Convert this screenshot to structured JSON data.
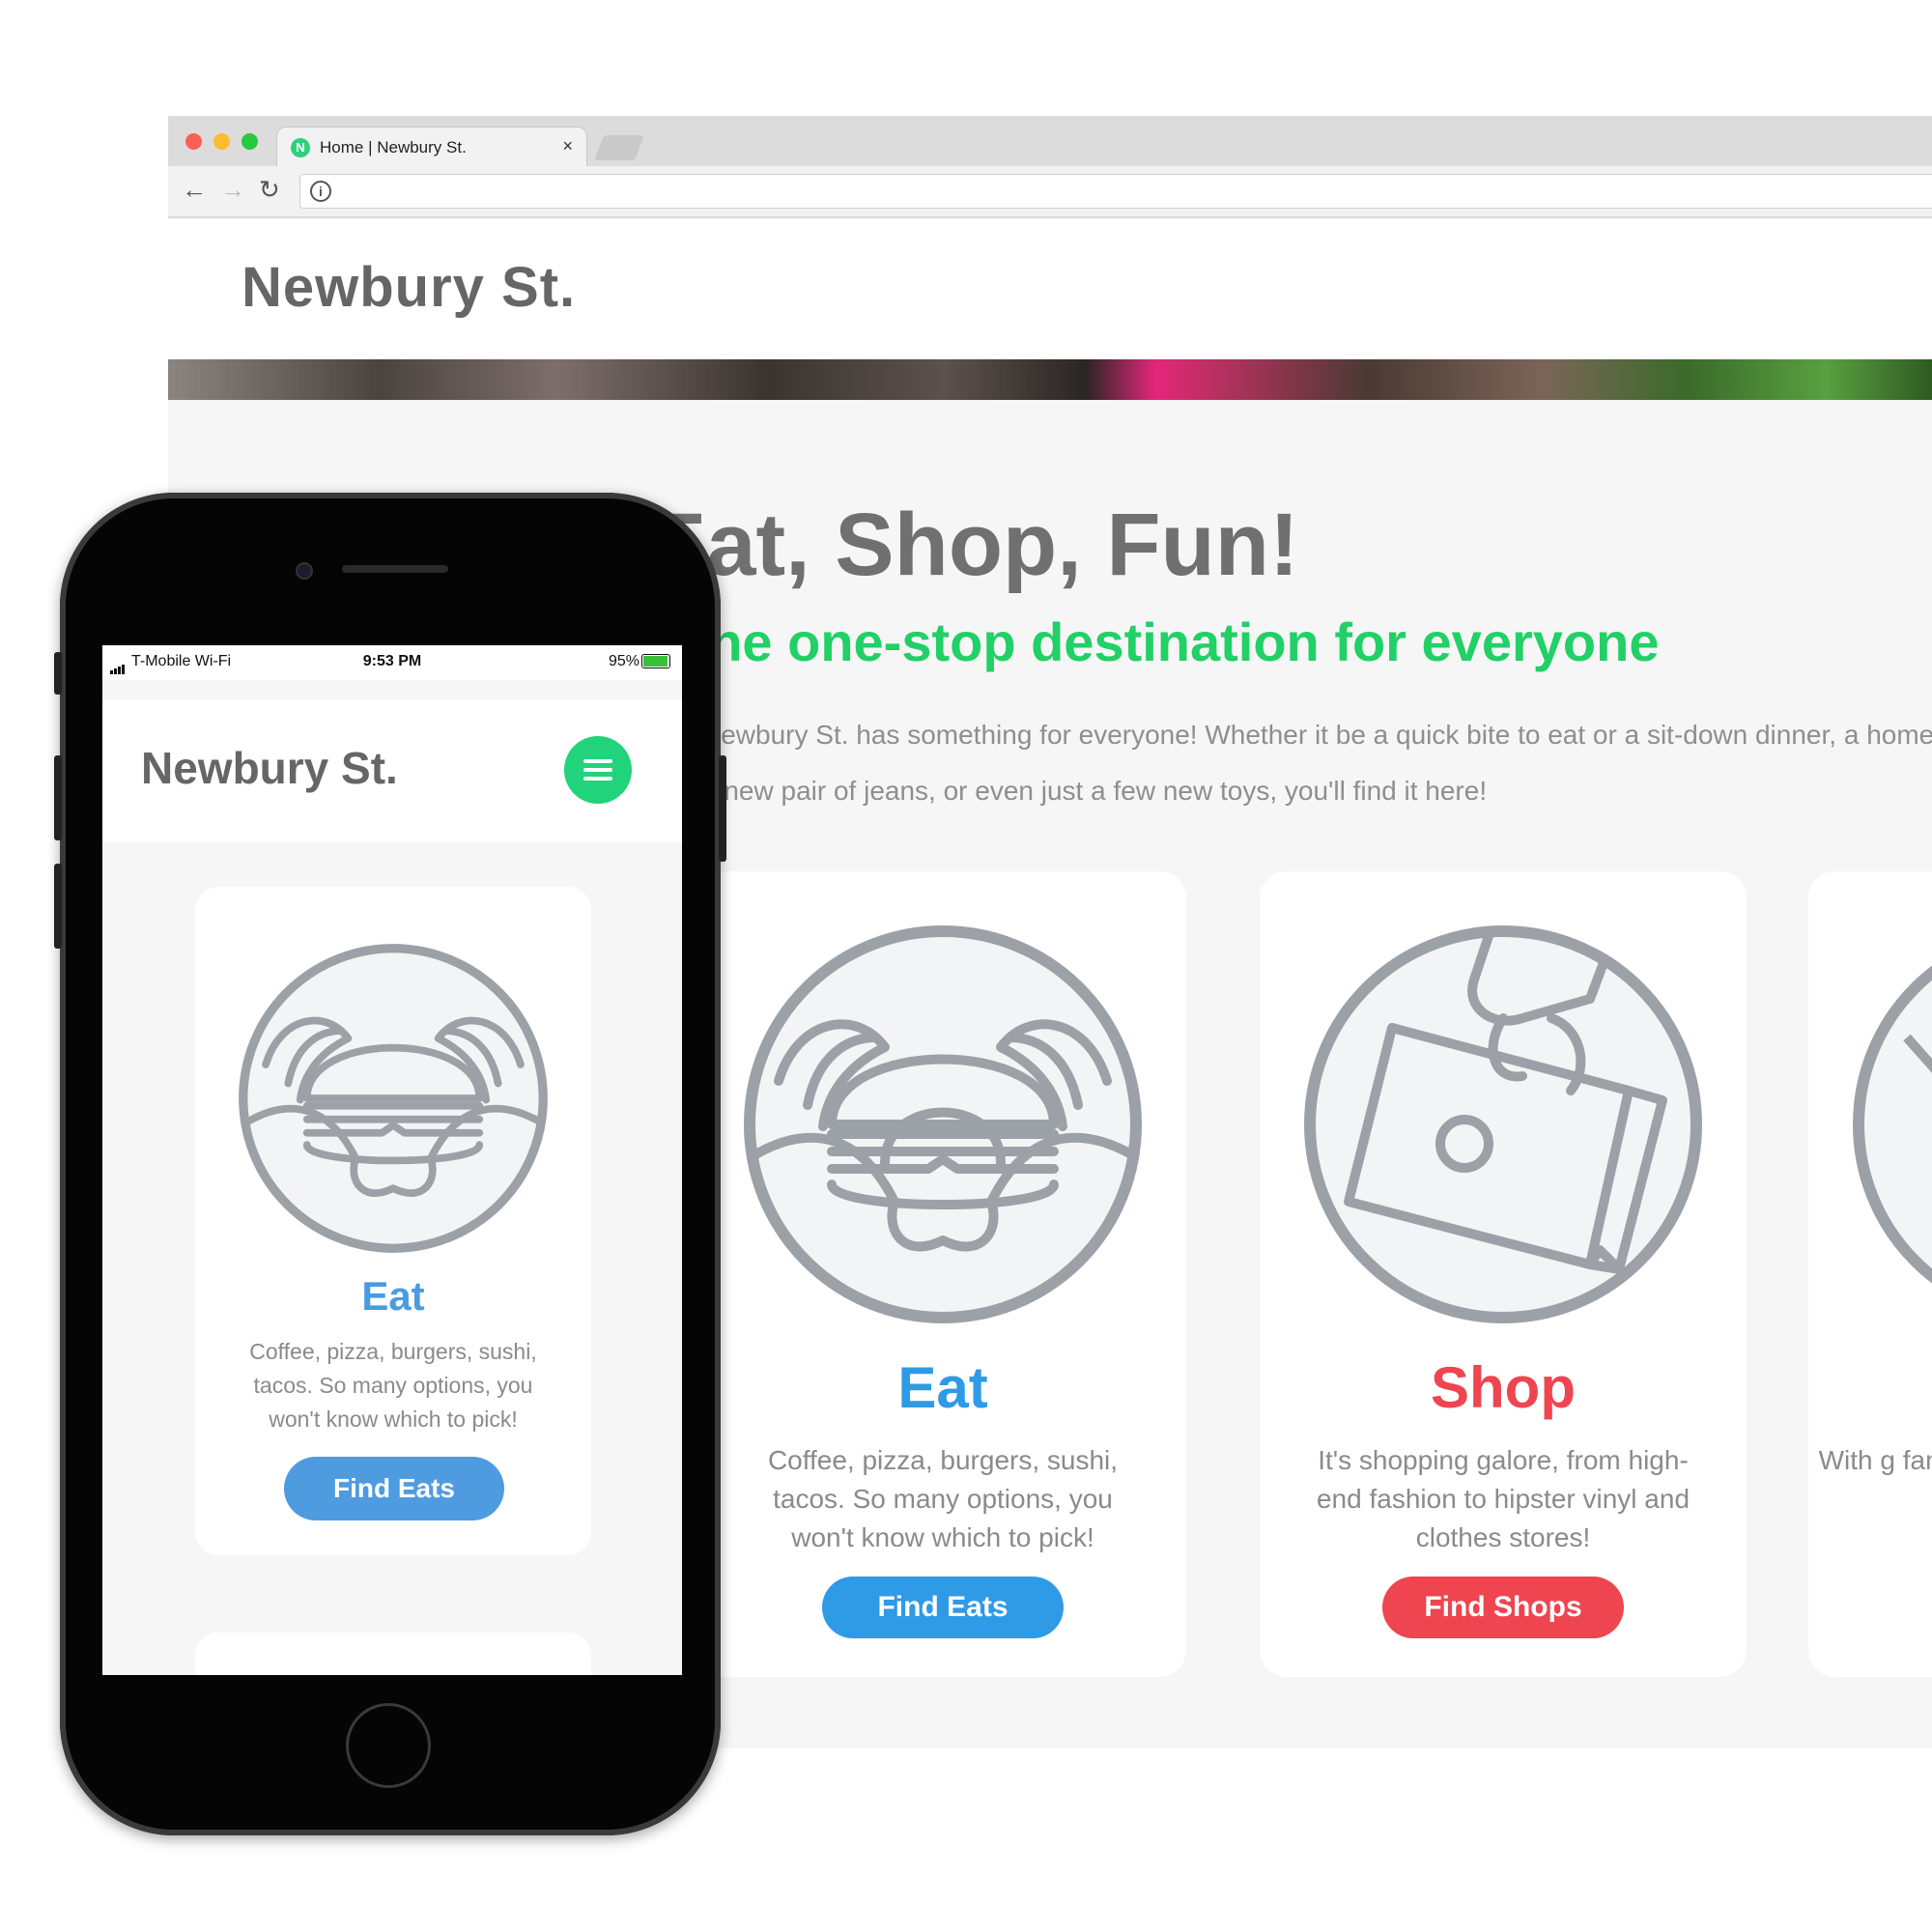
{
  "browser": {
    "tab_title": "Home | Newbury St.",
    "tab_favicon_letter": "N",
    "tab_close_glyph": "×",
    "nav": {
      "back_glyph": "←",
      "forward_glyph": "→",
      "reload_glyph": "↻",
      "info_glyph": "i"
    }
  },
  "site": {
    "logo": "Newbury St.",
    "hero": {
      "title": "Eat, Shop, Fun!",
      "subtitle": "The one-stop destination for everyone",
      "description": "Newbury St. has something for everyone! Whether it be a quick bite to eat or a sit-down dinner, a homecoming dance or a new pair of jeans, or even just a few new toys, you'll find it here!"
    },
    "cards": [
      {
        "title": "Eat",
        "description": "Coffee, pizza, burgers, sushi, tacos. So many options, you won't know which to pick!",
        "button": "Find Eats",
        "color": "#2f9ae6",
        "icon": "burger-hands-icon"
      },
      {
        "title": "Shop",
        "description": "It's shopping galore, from high-end fashion to hipster vinyl and clothes stores!",
        "button": "Find Shops",
        "color": "#ee4550",
        "icon": "shopping-bag-icon"
      },
      {
        "title": "",
        "description": "With g famo",
        "button": "",
        "color": "#f0a830",
        "icon": "fun-icon"
      }
    ]
  },
  "phone": {
    "status": {
      "carrier": "T-Mobile Wi-Fi",
      "time": "9:53 PM",
      "battery": "95%",
      "battery_level": 0.95
    },
    "logo": "Newbury St.",
    "card": {
      "title": "Eat",
      "description": "Coffee, pizza, burgers, sushi, tacos. So many options, you won't know which to pick!",
      "button": "Find Eats"
    }
  },
  "colors": {
    "green_accent": "#21d066",
    "eat_blue": "#2f9ae6",
    "shop_red": "#ee4550",
    "icon_gray": "#9ca1a7"
  }
}
